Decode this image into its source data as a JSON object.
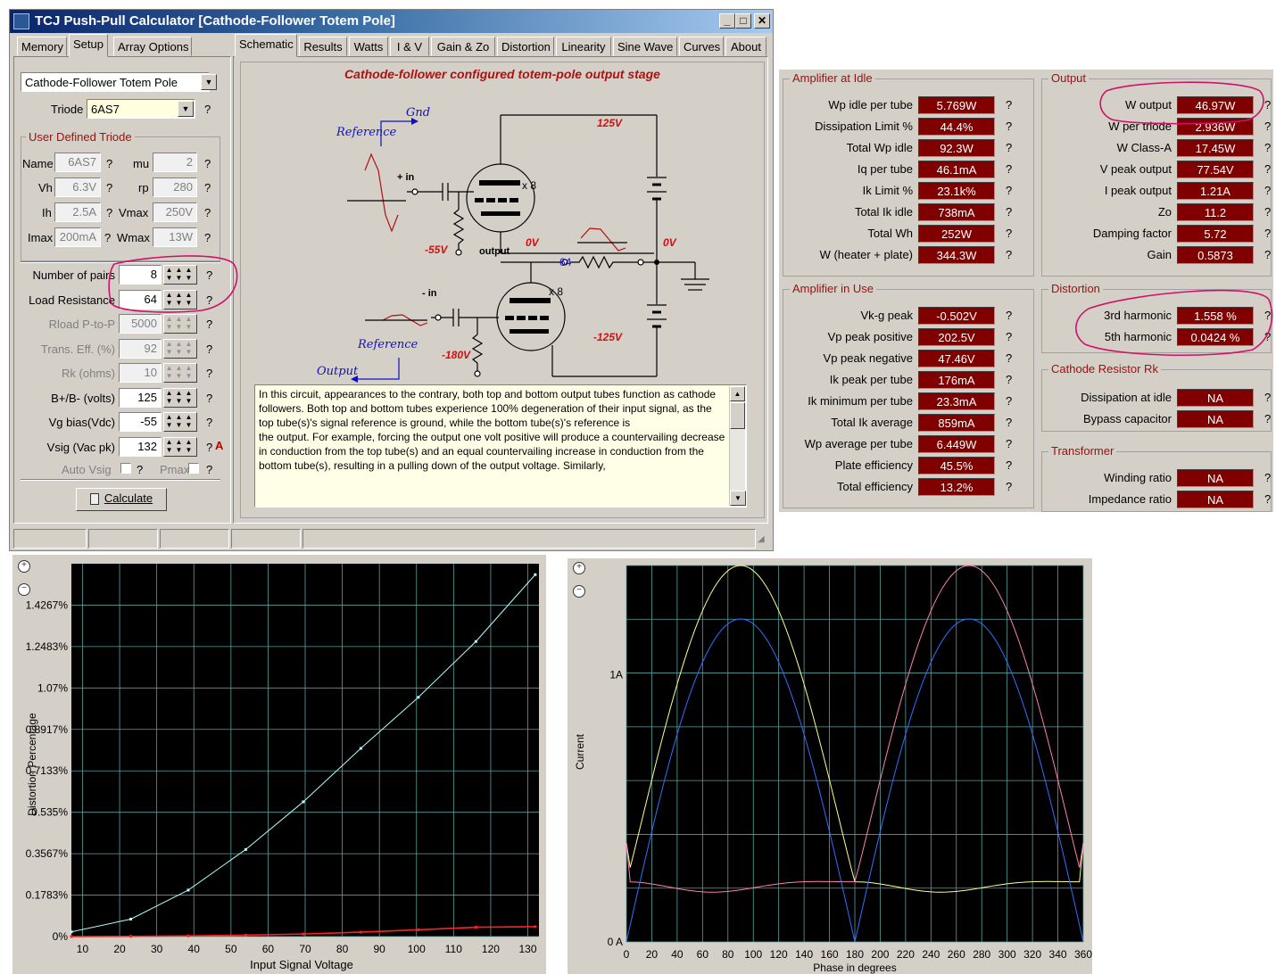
{
  "window": {
    "title": "TCJ Push-Pull Calculator [Cathode-Follower Totem Pole]",
    "buttons": [
      "_",
      "□",
      "✕"
    ]
  },
  "left_tabs": [
    "Memory",
    "Setup",
    "Array Options"
  ],
  "main_tabs": [
    "Schematic",
    "Results",
    "Watts",
    "I & V",
    "Gain & Zo",
    "Distortion",
    "Linearity",
    "Sine Wave",
    "Curves",
    "About"
  ],
  "setup": {
    "topology": "Cathode-Follower Totem Pole",
    "triode_label": "Triode",
    "triode": "6AS7",
    "udt": {
      "title": "User Defined Triode",
      "name_label": "Name",
      "name": "6AS7",
      "mu_label": "mu",
      "mu": "2",
      "vh_label": "Vh",
      "vh": "6.3V",
      "rp_label": "rp",
      "rp": "280",
      "ih_label": "Ih",
      "ih": "2.5A",
      "vmax_label": "Vmax",
      "vmax": "250V",
      "imax_label": "Imax",
      "imax": "200mA",
      "wmax_label": "Wmax",
      "wmax": "13W"
    },
    "params": [
      {
        "label": "Number of pairs",
        "value": "8",
        "enabled": true
      },
      {
        "label": "Load Resistance",
        "value": "64",
        "enabled": true
      },
      {
        "label": "Rload P-to-P",
        "value": "5000",
        "enabled": false
      },
      {
        "label": "Trans. Eff. (%)",
        "value": "92",
        "enabled": false
      },
      {
        "label": "Rk (ohms)",
        "value": "10",
        "enabled": false
      },
      {
        "label": "B+/B- (volts)",
        "value": "125",
        "enabled": true
      },
      {
        "label": "Vg bias(Vdc)",
        "value": "-55",
        "enabled": true
      },
      {
        "label": "Vsig (Vac pk)",
        "value": "132",
        "enabled": true
      }
    ],
    "auto_vsig_label": "Auto Vsig",
    "pmax_label": "Pmax",
    "a_marker": "A",
    "q": "?",
    "calculate": "Calculate"
  },
  "schematic": {
    "title": "Cathode-follower configured totem-pole output stage",
    "labels": {
      "gnd": "Gnd",
      "reference_top": "Reference",
      "plus_in": "+ in",
      "x8_top": "x 8",
      "v125": "125V",
      "vm55": "-55V",
      "output_node": "output",
      "v0_a": "0V",
      "r64": "64",
      "v0_b": "0V",
      "minus_in": "- in",
      "x8_bot": "x 8",
      "reference_bot": "Reference",
      "vm125": "-125V",
      "vm180": "-180V",
      "output_lbl": "Output"
    },
    "description": "In this circuit, appearances to the contrary, both top and bottom output tubes function as cathode followers. Both top and bottom tubes experience 100% degeneration of their input signal, as the top tube(s)'s signal reference is ground, while the bottom tube(s)'s reference is\nthe output. For example, forcing the output one volt positive will produce a countervailing decrease in conduction from the top tube(s) and an equal countervailing increase in conduction from the bottom tube(s), resulting in a pulling down of the output voltage. Similarly,"
  },
  "results": {
    "idle": {
      "title": "Amplifier at Idle",
      "rows": [
        {
          "label": "Wp idle per tube",
          "value": "5.769W"
        },
        {
          "label": "Dissipation Limit %",
          "value": "44.4%"
        },
        {
          "label": "Total Wp idle",
          "value": "92.3W"
        },
        {
          "label": "Iq per tube",
          "value": "46.1mA"
        },
        {
          "label": "Ik Limit %",
          "value": "23.1k%"
        },
        {
          "label": "Total Ik idle",
          "value": "738mA"
        },
        {
          "label": "Total Wh",
          "value": "252W"
        },
        {
          "label": "W (heater + plate)",
          "value": "344.3W"
        }
      ]
    },
    "inuse": {
      "title": "Amplifier in Use",
      "rows": [
        {
          "label": "Vk-g peak",
          "value": "-0.502V"
        },
        {
          "label": "Vp peak positive",
          "value": "202.5V"
        },
        {
          "label": "Vp peak negative",
          "value": "47.46V"
        },
        {
          "label": "Ik peak per tube",
          "value": "176mA"
        },
        {
          "label": "Ik minimum per tube",
          "value": "23.3mA"
        },
        {
          "label": "Total Ik average",
          "value": "859mA"
        },
        {
          "label": "Wp average per tube",
          "value": "6.449W"
        },
        {
          "label": "Plate efficiency",
          "value": "45.5%"
        },
        {
          "label": "Total efficiency",
          "value": "13.2%"
        }
      ]
    },
    "output": {
      "title": "Output",
      "rows": [
        {
          "label": "W output",
          "value": "46.97W"
        },
        {
          "label": "W per triode",
          "value": "2.936W"
        },
        {
          "label": "W Class-A",
          "value": "17.45W"
        },
        {
          "label": "V peak output",
          "value": "77.54V"
        },
        {
          "label": "I peak output",
          "value": "1.21A"
        },
        {
          "label": "Zo",
          "value": "11.2"
        },
        {
          "label": "Damping factor",
          "value": "5.72"
        },
        {
          "label": "Gain",
          "value": "0.5873"
        }
      ]
    },
    "distortion": {
      "title": "Distortion",
      "rows": [
        {
          "label": "3rd harmonic",
          "value": "1.558 %"
        },
        {
          "label": "5th harmonic",
          "value": "0.0424 %"
        }
      ]
    },
    "rk": {
      "title": "Cathode Resistor Rk",
      "rows": [
        {
          "label": "Dissipation at idle",
          "value": "NA"
        },
        {
          "label": "Bypass capacitor",
          "value": "NA"
        }
      ]
    },
    "transformer": {
      "title": "Transformer",
      "rows": [
        {
          "label": "Winding ratio",
          "value": "NA"
        },
        {
          "label": "Impedance ratio",
          "value": "NA"
        }
      ]
    }
  },
  "colors": {
    "value_bg": "#800000",
    "annotation": "#d0106a",
    "chart_bg": "#000000",
    "grid": "#5aa0a0",
    "series_cyan": "#b0ffff",
    "series_red": "#ff2020",
    "series_yellow": "#ffff90",
    "series_pink": "#ff80b0",
    "series_blue": "#3070ff"
  },
  "chart_data": [
    {
      "type": "line",
      "xlabel": "Input Signal Voltage",
      "ylabel": "Distortion Percentage",
      "x_ticks": [
        "10",
        "20",
        "30",
        "40",
        "50",
        "60",
        "70",
        "80",
        "90",
        "100",
        "110",
        "120",
        "130"
      ],
      "y_ticks": [
        "0%",
        "0.1783%",
        "0.3567%",
        "0.535%",
        "0.7133%",
        "0.8917%",
        "1.07%",
        "1.2483%",
        "1.4267%"
      ],
      "xlim": [
        7,
        133
      ],
      "ylim": [
        0,
        1.605
      ],
      "grid": true,
      "series": [
        {
          "x": [
            7,
            23,
            38.5,
            54,
            69.5,
            85,
            100.5,
            116,
            132
          ],
          "y": [
            0.02,
            0.075,
            0.2,
            0.375,
            0.58,
            0.81,
            1.03,
            1.27,
            1.558
          ]
        },
        {
          "x": [
            7,
            23,
            38.5,
            54,
            69.5,
            85,
            100.5,
            116,
            132
          ],
          "y": [
            0.0,
            0.001,
            0.003,
            0.006,
            0.011,
            0.019,
            0.029,
            0.04,
            0.0424
          ]
        }
      ]
    },
    {
      "type": "line",
      "xlabel": "Phase in degrees",
      "ylabel": "Current",
      "x_ticks": [
        "0",
        "20",
        "40",
        "60",
        "80",
        "100",
        "120",
        "140",
        "160",
        "180",
        "200",
        "220",
        "240",
        "260",
        "280",
        "300",
        "320",
        "340",
        "360"
      ],
      "y_ticks": [
        "0 A",
        "1A"
      ],
      "xlim": [
        0,
        360
      ],
      "ylim": [
        0,
        1.41
      ],
      "grid": true
    }
  ]
}
